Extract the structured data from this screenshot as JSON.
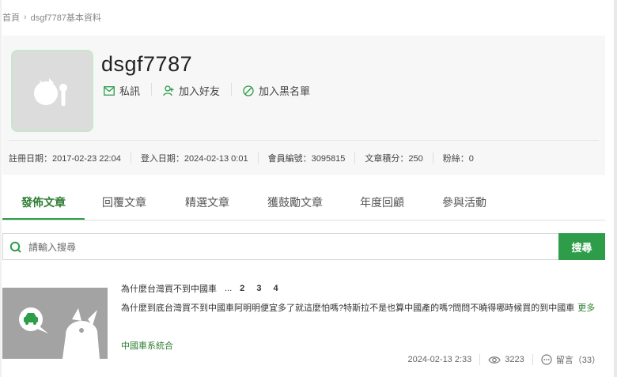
{
  "breadcrumb": {
    "home": "首頁",
    "current": "dsgf7787基本資料"
  },
  "profile": {
    "username": "dsgf7787",
    "actions": {
      "message": "私訊",
      "add_friend": "加入好友",
      "block": "加入黑名單"
    },
    "meta": {
      "registered": "註冊日期：2017-02-23 22:04",
      "last_login": "登入日期：2024-02-13 0:01",
      "member_id": "會員編號：3095815",
      "article_points": "文章積分：250",
      "fans": "粉絲：0"
    }
  },
  "tabs": [
    "發佈文章",
    "回覆文章",
    "精選文章",
    "獲鼓勵文章",
    "年度回顧",
    "參與活動"
  ],
  "search": {
    "placeholder": "請輸入搜尋",
    "button": "搜尋"
  },
  "post": {
    "title": "為什麼台灣買不到中國車",
    "pages_prefix": "...",
    "pages": "2 3 4",
    "excerpt": "為什麼到底台灣買不到中國車阿明明便宜多了就這麼怕嗎?特斯拉不是也算中國產的嗎?問問不曉得哪時候買的到中國車",
    "more": "更多",
    "board": "中國車系統合",
    "date": "2024-02-13 2:33",
    "views": "3223",
    "comments": "留言（33）"
  },
  "colors": {
    "accent": "#2e9d49",
    "accent_text": "#2e7d32"
  }
}
